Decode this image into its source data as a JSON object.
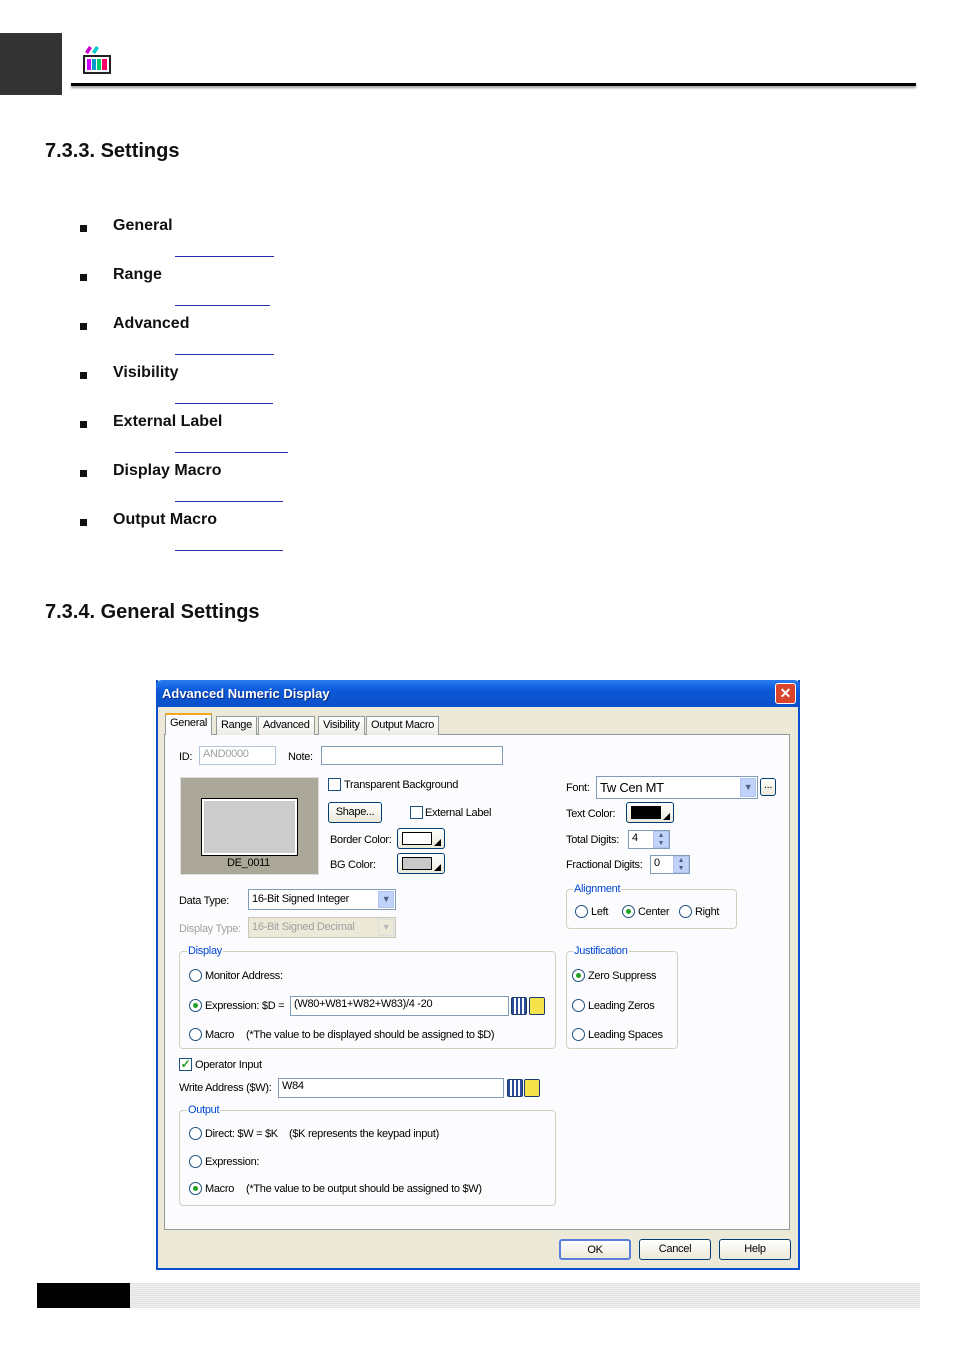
{
  "header": {
    "logo_icon": "palette-app-icon"
  },
  "sections": [
    {
      "title": "7.3.3. Settings"
    },
    {
      "title": "7.3.4. General Settings"
    }
  ],
  "settings_list": [
    "General",
    "Range",
    "Advanced",
    "Visibility",
    "External Label",
    "Display Macro",
    "Output Macro"
  ],
  "dialog": {
    "title": "Advanced Numeric Display",
    "close_icon": "close-icon",
    "tabs": [
      "General",
      "Range",
      "Advanced",
      "Visibility",
      "Output Macro"
    ],
    "active_tab": "General",
    "id_label": "ID:",
    "id_value": "AND0000",
    "note_label": "Note:",
    "note_value": "",
    "preview_label": "DE_0011",
    "transparent_bg": {
      "label": "Transparent Background",
      "checked": false
    },
    "shape_button": "Shape...",
    "external_label": {
      "label": "External Label",
      "checked": false
    },
    "border_color_label": "Border Color:",
    "border_color": "#ffffff",
    "bg_color_label": "BG Color:",
    "bg_color": "#c8c8c8",
    "font_label": "Font:",
    "font_value": "Tw Cen MT",
    "font_more": "...",
    "text_color_label": "Text Color:",
    "text_color": "#000000",
    "total_digits_label": "Total Digits:",
    "total_digits": "4",
    "fractional_digits_label": "Fractional Digits:",
    "fractional_digits": "0",
    "data_type_label": "Data Type:",
    "data_type": "16-Bit Signed Integer",
    "display_type_label": "Display Type:",
    "display_type": "16-Bit Signed Decimal",
    "alignment": {
      "title": "Alignment",
      "options": [
        "Left",
        "Center",
        "Right"
      ],
      "selected": "Center"
    },
    "display": {
      "title": "Display",
      "monitor": "Monitor Address:",
      "expression": "Expression:  $D =",
      "expression_value": "(W80+W81+W82+W83)/4 -20",
      "macro": "Macro",
      "macro_note": "(*The value to be displayed should be assigned to $D)",
      "selected": "Expression"
    },
    "justification": {
      "title": "Justification",
      "options": [
        "Zero Suppress",
        "Leading Zeros",
        "Leading Spaces"
      ],
      "selected": "Zero Suppress"
    },
    "operator_input": {
      "label": "Operator Input",
      "checked": true
    },
    "write_address_label": "Write Address ($W):",
    "write_address": "W84",
    "output": {
      "title": "Output",
      "direct": "Direct:  $W = $K",
      "direct_note": "($K represents the keypad input)",
      "expression": "Expression:",
      "macro": "Macro",
      "macro_note": "(*The value to be output should be assigned to $W)",
      "selected": "Macro"
    },
    "buttons": {
      "ok": "OK",
      "cancel": "Cancel",
      "help": "Help"
    }
  },
  "colors": {
    "titlebar": "#0a58d8",
    "dialog_bg": "#ece9d8",
    "group_title": "#0046d5"
  }
}
